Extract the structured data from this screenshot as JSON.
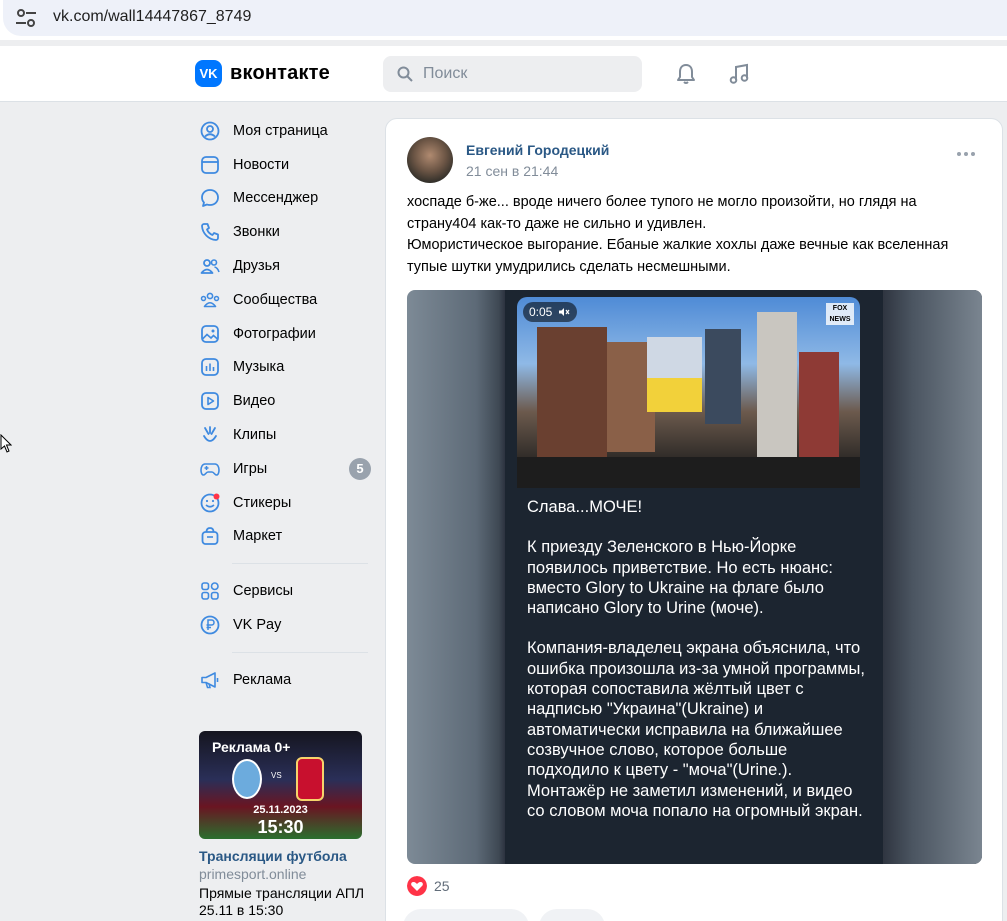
{
  "browser": {
    "url": "vk.com/wall14447867_8749"
  },
  "header": {
    "logo_mark": "VK",
    "logo_text": "вконтакте",
    "search_placeholder": "Поиск"
  },
  "nav": {
    "items": [
      {
        "label": "Моя страница",
        "icon": "profile-icon"
      },
      {
        "label": "Новости",
        "icon": "news-icon"
      },
      {
        "label": "Мессенджер",
        "icon": "messenger-icon"
      },
      {
        "label": "Звонки",
        "icon": "phone-icon"
      },
      {
        "label": "Друзья",
        "icon": "friends-icon"
      },
      {
        "label": "Сообщества",
        "icon": "communities-icon"
      },
      {
        "label": "Фотографии",
        "icon": "photos-icon"
      },
      {
        "label": "Музыка",
        "icon": "music-icon"
      },
      {
        "label": "Видео",
        "icon": "video-icon"
      },
      {
        "label": "Клипы",
        "icon": "clips-icon"
      },
      {
        "label": "Игры",
        "icon": "games-icon",
        "badge": "5"
      },
      {
        "label": "Стикеры",
        "icon": "stickers-icon"
      },
      {
        "label": "Маркет",
        "icon": "market-icon"
      }
    ],
    "items2": [
      {
        "label": "Сервисы",
        "icon": "services-icon"
      },
      {
        "label": "VK Pay",
        "icon": "vkpay-icon"
      }
    ],
    "items3": [
      {
        "label": "Реклама",
        "icon": "ads-icon"
      }
    ]
  },
  "ad": {
    "tag": "Реклама 0+",
    "vs": "VS",
    "date": "25.11.2023",
    "time": "15:30",
    "title": "Трансляции футбола",
    "domain": "primesport.online",
    "desc": "Прямые трансляции АПЛ 25.11 в 15:30"
  },
  "post": {
    "author": "Евгений Городецкий",
    "date": "21 сен в 21:44",
    "text_lines": [
      "хоспаде б-же... вроде ничего более тупого не могло произойти, но глядя на",
      "страну404 как-то даже не сильно и удивлен.",
      "Юмористическое выгорание. Ебаные жалкие хохлы даже вечные как вселенная",
      "тупые шутки умудрились сделать несмешными."
    ],
    "media": {
      "video_time": "0:05",
      "channel_logo": "FOX NEWS",
      "paragraphs": [
        "Слава...МОЧЕ!",
        "К приезду Зеленского в Нью-Йорке появилось приветствие. Но есть нюанс: вместо Glory to Ukraine на флаге было написано Glory to Urine (моче).",
        "Компания-владелец экрана объяснила, что ошибка произошла из-за умной программы, которая сопоставила жёлтый цвет с надписью \"Украина\"(Ukraine) и автоматически исправила на ближайшее созвучное слово, которое больше подходило к цвету - \"моча\"(Urine.). Монтажёр не заметил изменений, и видео со словом моча попало на огромный экран."
      ]
    },
    "likes": "25"
  }
}
